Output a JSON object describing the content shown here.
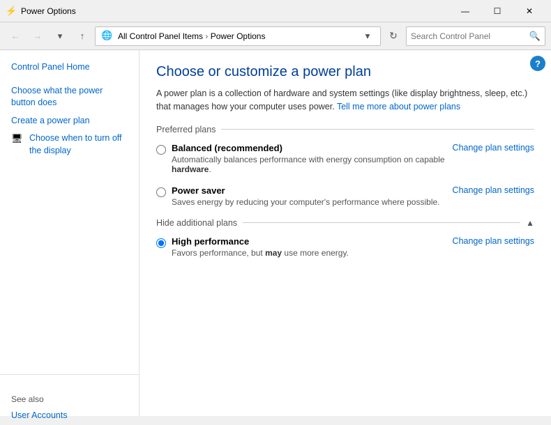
{
  "titlebar": {
    "icon": "⚡",
    "title": "Power Options",
    "minimize_label": "—",
    "maximize_label": "☐",
    "close_label": "✕"
  },
  "navbar": {
    "back_label": "←",
    "forward_label": "→",
    "dropdown_label": "▾",
    "up_label": "↑",
    "address": {
      "icon_label": "🌐",
      "crumb1": "All Control Panel Items",
      "separator": ">",
      "crumb2": "Power Options"
    },
    "refresh_label": "↻",
    "search_placeholder": "Search Control Panel",
    "search_icon_label": "🔍"
  },
  "sidebar": {
    "home_label": "Control Panel Home",
    "links": [
      {
        "id": "power-button",
        "label": "Choose what the power button does"
      },
      {
        "id": "create-plan",
        "label": "Create a power plan"
      },
      {
        "id": "turn-off-display",
        "label": "Choose when to turn off the display",
        "has_icon": true
      }
    ],
    "see_also_label": "See also",
    "user_accounts_label": "User Accounts"
  },
  "content": {
    "help_label": "?",
    "page_title": "Choose or customize a power plan",
    "description_text": "A power plan is a collection of hardware and system settings (like display brightness, sleep, etc.) that manages how your computer uses power. ",
    "description_link": "Tell me more about power plans",
    "preferred_plans_label": "Preferred plans",
    "plans": [
      {
        "id": "balanced",
        "name": "Balanced (recommended)",
        "description": "Automatically balances performance with energy consumption on capable ",
        "description_bold": "hardware",
        "change_link": "Change plan settings",
        "selected": false
      },
      {
        "id": "power-saver",
        "name": "Power saver",
        "description": "Saves energy by reducing your computer's performance where possible.",
        "description_bold": "",
        "change_link": "Change plan settings",
        "selected": false
      }
    ],
    "hide_additional_label": "Hide additional plans",
    "additional_plans": [
      {
        "id": "high-performance",
        "name": "High performance",
        "description": "Favors performance, but ",
        "description_bold": "may",
        "description_after": " use more energy.",
        "change_link": "Change plan settings",
        "selected": true
      }
    ]
  }
}
